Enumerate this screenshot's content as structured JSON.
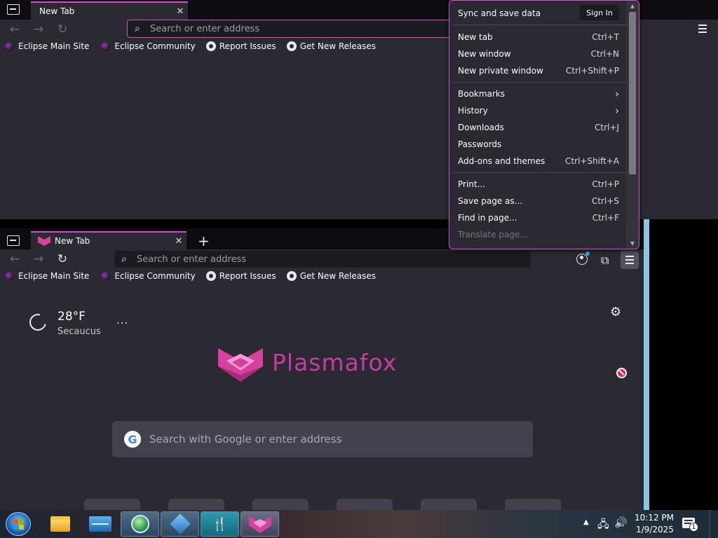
{
  "back_window": {
    "tab_title": "New Tab",
    "url_placeholder": "Search or enter address",
    "bookmarks": [
      "Eclipse Main Site",
      "Eclipse Community",
      "Report Issues",
      "Get New Releases"
    ]
  },
  "menu": {
    "sync_label": "Sync and save data",
    "sign_in": "Sign In",
    "items": [
      {
        "label": "New tab",
        "shortcut": "Ctrl+T"
      },
      {
        "label": "New window",
        "shortcut": "Ctrl+N"
      },
      {
        "label": "New private window",
        "shortcut": "Ctrl+Shift+P"
      },
      {
        "label": "Bookmarks",
        "shortcut": ""
      },
      {
        "label": "History",
        "shortcut": ""
      },
      {
        "label": "Downloads",
        "shortcut": "Ctrl+J"
      },
      {
        "label": "Passwords",
        "shortcut": ""
      },
      {
        "label": "Add-ons and themes",
        "shortcut": "Ctrl+Shift+A"
      },
      {
        "label": "Print...",
        "shortcut": "Ctrl+P"
      },
      {
        "label": "Save page as...",
        "shortcut": "Ctrl+S"
      },
      {
        "label": "Find in page...",
        "shortcut": "Ctrl+F"
      },
      {
        "label": "Translate page...",
        "shortcut": ""
      }
    ]
  },
  "front_window": {
    "tab_title": "New Tab",
    "new_tab_symbol": "+",
    "url_placeholder": "Search or enter address",
    "bookmarks": [
      "Eclipse Main Site",
      "Eclipse Community",
      "Report Issues",
      "Get New Releases"
    ],
    "weather": {
      "temp": "28°F",
      "location": "Secaucus",
      "more": "..."
    },
    "brand": "Plasmafox",
    "search_placeholder": "Search with Google or enter address"
  },
  "taskbar": {
    "time": "10:12 PM",
    "date": "1/9/2025",
    "notification_count": "1"
  },
  "colors": {
    "accent": "#d94fd0",
    "brand": "#c83aa4",
    "background": "#2b2a33"
  }
}
